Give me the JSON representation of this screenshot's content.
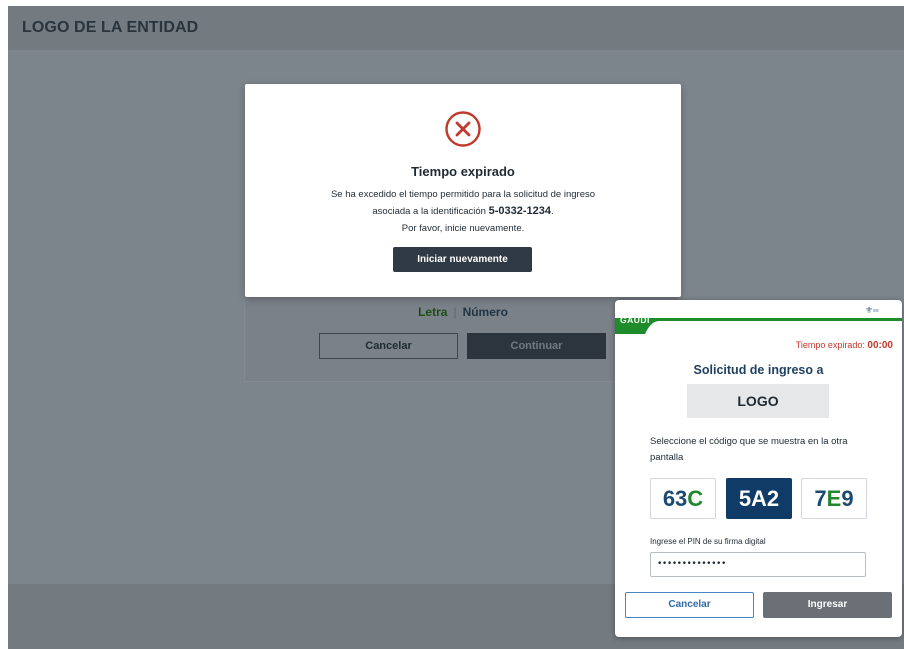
{
  "app": {
    "logo_text": "LOGO DE LA ENTIDAD",
    "background_form": {
      "toggle_letra": "Letra",
      "toggle_separator": "|",
      "toggle_numero": "Número",
      "cancel_label": "Cancelar",
      "continue_label": "Continuar"
    }
  },
  "modal": {
    "icon": "error-x-circle-icon",
    "title": "Tiempo expirado",
    "line1": "Se ha excedido el tiempo permitido para la solicitud de ingreso",
    "line2_prefix": "asociada a la identificación",
    "identification": "5-0332-1234",
    "line2_suffix": ".",
    "line3": "Por favor, inicie nuevamente.",
    "restart_label": "Iniciar nuevamente"
  },
  "panel": {
    "brand": "GAUDI",
    "gov_logo_icon": "government-seal-icon",
    "expire_label": "Tiempo expirado:",
    "expire_time": "00:00",
    "title": "Solicitud de ingreso a",
    "logo_placeholder": "LOGO",
    "instructions": "Seleccione el código que se muestra en la otra pantalla",
    "codes": [
      {
        "digits": "63",
        "letter": "C"
      },
      {
        "digits": "5A2",
        "letter": ""
      },
      {
        "digits": "7",
        "letter": "E",
        "digits_after": "9"
      }
    ],
    "pin_label": "Ingrese el PIN de su firma digital",
    "pin_value": "••••••••••••••",
    "cancel_label": "Cancelar",
    "enter_label": "Ingresar"
  },
  "colors": {
    "overlay": "#7d858c",
    "modal_button": "#2f3a44",
    "error_red": "#c0392b",
    "gaudi_green": "#1e8c2a",
    "code_blue": "#1b4a72",
    "code_green": "#23872f",
    "selected_code_bg": "#0f3b66"
  }
}
